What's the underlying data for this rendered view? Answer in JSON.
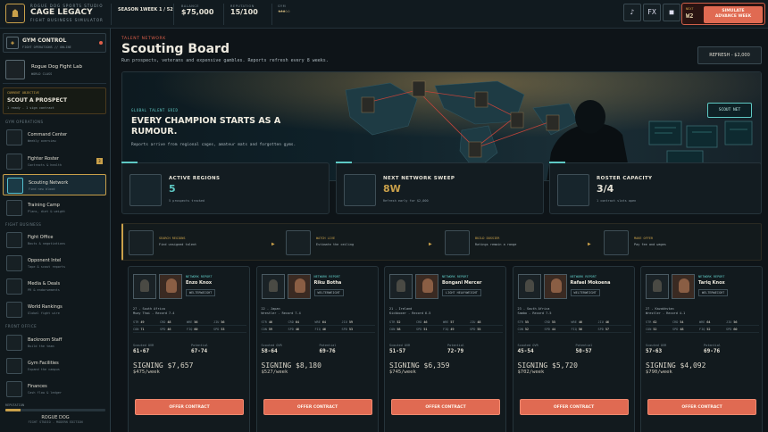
{
  "top": {
    "brand_small": "ROGUE DOG SPORTS STUDIO",
    "brand": "CAGE LEGACY",
    "brand_sub": "FIGHT BUSINESS SIMULATOR",
    "season": "SEASON 1",
    "week": "WEEK 1 / 52",
    "balance_label": "BALANCE",
    "balance": "$75,000",
    "reputation_label": "REPUTATION",
    "reputation": "15/100",
    "gym_label": "GYM",
    "gym_rating": 3,
    "btn_music": "♪",
    "btn_fx": "FX",
    "btn_pause": "■",
    "next_label": "NEXT",
    "next_week": "W2",
    "advance_small": "SIMULATE",
    "advance_label": "ADVANCE WEEK"
  },
  "sidebar": {
    "gym_title": "GYM CONTROL",
    "gym_sub": "FIGHT OPERATIONS // ONLINE",
    "lab_name": "Rogue Dog Fight Lab",
    "lab_sub": "WORLD CLASS",
    "objective_label": "CURRENT OBJECTIVE",
    "objective_title": "SCOUT A PROSPECT",
    "objective_progress": "1 ready - 1 sign contract",
    "section_ops": "GYM OPERATIONS",
    "section_business": "FIGHT BUSINESS",
    "section_office": "FRONT OFFICE",
    "items": [
      {
        "label": "Command Center",
        "sub": "Weekly overview"
      },
      {
        "label": "Fighter Roster",
        "sub": "Contracts & health",
        "badge": "3"
      },
      {
        "label": "Scouting Network",
        "sub": "Find new blood"
      },
      {
        "label": "Training Camp",
        "sub": "Plans, diet & weight"
      },
      {
        "label": "Fight Office",
        "sub": "Bouts & negotiations"
      },
      {
        "label": "Opponent Intel",
        "sub": "Tape & scout reports"
      },
      {
        "label": "Media & Deals",
        "sub": "PR & endorsements"
      },
      {
        "label": "World Rankings",
        "sub": "Global fight wire"
      },
      {
        "label": "Backroom Staff",
        "sub": "Build the team"
      },
      {
        "label": "Gym Facilities",
        "sub": "Expand the campus"
      },
      {
        "label": "Finances",
        "sub": "Cash flow & ledger"
      }
    ],
    "reputation_label": "REPUTATION",
    "reputation_value": 0.15,
    "footer_name": "ROGUE DOG",
    "footer_sub": "FIGHT STUDIO - MODERN EDITION"
  },
  "main": {
    "kicker": "TALENT NETWORK",
    "title": "Scouting Board",
    "subtitle": "Run prospects, veterans and expensive gambles. Reports refresh every 8 weeks.",
    "refresh_label": "REFRESH - $2,000",
    "hero_kicker": "GLOBAL TALENT GRID",
    "hero_title": "EVERY CHAMPION STARTS AS A RUMOUR.",
    "hero_desc": "Reports arrive from regional cages, amateur mats and forgotten gyms.",
    "hero_button": "SCOUT NET",
    "stats": [
      {
        "label": "ACTIVE REGIONS",
        "value": "5",
        "sub": "5 prospects tracked"
      },
      {
        "label": "NEXT NETWORK SWEEP",
        "value": "8W",
        "sub": "Refresh early for $2,000"
      },
      {
        "label": "ROSTER CAPACITY",
        "value": "3/4",
        "sub": "1 contract slots open"
      }
    ],
    "steps": [
      {
        "title": "SEARCH REGIONS",
        "sub": "Find unsigned talent"
      },
      {
        "title": "WATCH LIVE",
        "sub": "Estimate the ceiling"
      },
      {
        "title": "BUILD DOSSIER",
        "sub": "Ratings remain a range"
      },
      {
        "title": "MAKE OFFER",
        "sub": "Pay fee and wages"
      }
    ]
  },
  "cards": [
    {
      "report": "NETWORK REPORT",
      "name": "Enzo Knox",
      "weight": "WELTERWEIGHT",
      "meta1": "27 - South Africa",
      "meta2": "Muay Thai - Record 7-4",
      "attrs": [
        [
          "STR",
          "49"
        ],
        [
          "CRD",
          "48"
        ],
        [
          "WRE",
          "56"
        ],
        [
          "JIU",
          "56"
        ],
        [
          "CON",
          "71"
        ],
        [
          "SPD",
          "46"
        ],
        [
          "FIQ",
          "60"
        ],
        [
          "SPD",
          "53"
        ]
      ],
      "cur_label": "Scouted OVR",
      "cur": "61-67",
      "pot_label": "Potential",
      "pot": "67-74",
      "signing": "SIGNING $7,657",
      "weekly": "$475/week",
      "offer": "OFFER CONTRACT"
    },
    {
      "report": "NETWORK REPORT",
      "name": "Riku Botha",
      "weight": "WELTERWEIGHT",
      "meta1": "22 - Japan",
      "meta2": "Wrestler - Record 7-4",
      "attrs": [
        [
          "STR",
          "46"
        ],
        [
          "CRD",
          "64"
        ],
        [
          "WRE",
          "64"
        ],
        [
          "JIU",
          "59"
        ],
        [
          "CON",
          "59"
        ],
        [
          "SPD",
          "46"
        ],
        [
          "FIQ",
          "46"
        ],
        [
          "SPD",
          "53"
        ]
      ],
      "cur_label": "Scouted OVR",
      "cur": "58-64",
      "pot_label": "Potential",
      "pot": "69-76",
      "signing": "SIGNING $8,180",
      "weekly": "$527/week",
      "offer": "OFFER CONTRACT"
    },
    {
      "report": "NETWORK REPORT",
      "name": "Bongani Mercer",
      "weight": "LIGHT HEAVYWEIGHT",
      "meta1": "21 - Ireland",
      "meta2": "Kickboxer - Record 6-5",
      "attrs": [
        [
          "STR",
          "52"
        ],
        [
          "CRD",
          "46"
        ],
        [
          "WRE",
          "57"
        ],
        [
          "JIU",
          "48"
        ],
        [
          "CON",
          "58"
        ],
        [
          "SPD",
          "51"
        ],
        [
          "FIQ",
          "49"
        ],
        [
          "SPD",
          "55"
        ]
      ],
      "cur_label": "Scouted OVR",
      "cur": "51-57",
      "pot_label": "Potential",
      "pot": "72-79",
      "signing": "SIGNING $6,359",
      "weekly": "$745/week",
      "offer": "OFFER CONTRACT"
    },
    {
      "report": "NETWORK REPORT",
      "name": "Rafael Mokoena",
      "weight": "WELTERWEIGHT",
      "meta1": "23 - South Africa",
      "meta2": "Sambo - Record 7-5",
      "attrs": [
        [
          "STR",
          "55"
        ],
        [
          "CRD",
          "55"
        ],
        [
          "WRE",
          "46"
        ],
        [
          "JIU",
          "46"
        ],
        [
          "CON",
          "52"
        ],
        [
          "SPD",
          "44"
        ],
        [
          "FIQ",
          "56"
        ],
        [
          "SPD",
          "57"
        ]
      ],
      "cur_label": "Scouted OVR",
      "cur": "45-54",
      "pot_label": "Potential",
      "pot": "50-57",
      "signing": "SIGNING $5,720",
      "weekly": "$702/week",
      "offer": "OFFER CONTRACT"
    },
    {
      "report": "NETWORK REPORT",
      "name": "Tariq Knox",
      "weight": "WELTERWEIGHT",
      "meta1": "27 - Kazakhstan",
      "meta2": "Wrestler - Record 4-1",
      "attrs": [
        [
          "STR",
          "62"
        ],
        [
          "CRD",
          "54"
        ],
        [
          "WRE",
          "64"
        ],
        [
          "JIU",
          "56"
        ],
        [
          "CON",
          "52"
        ],
        [
          "SPD",
          "48"
        ],
        [
          "FIQ",
          "52"
        ],
        [
          "SPD",
          "60"
        ]
      ],
      "cur_label": "Scouted OVR",
      "cur": "57-63",
      "pot_label": "Potential",
      "pot": "69-76",
      "signing": "SIGNING $4,092",
      "weekly": "$790/week",
      "offer": "OFFER CONTRACT"
    }
  ]
}
